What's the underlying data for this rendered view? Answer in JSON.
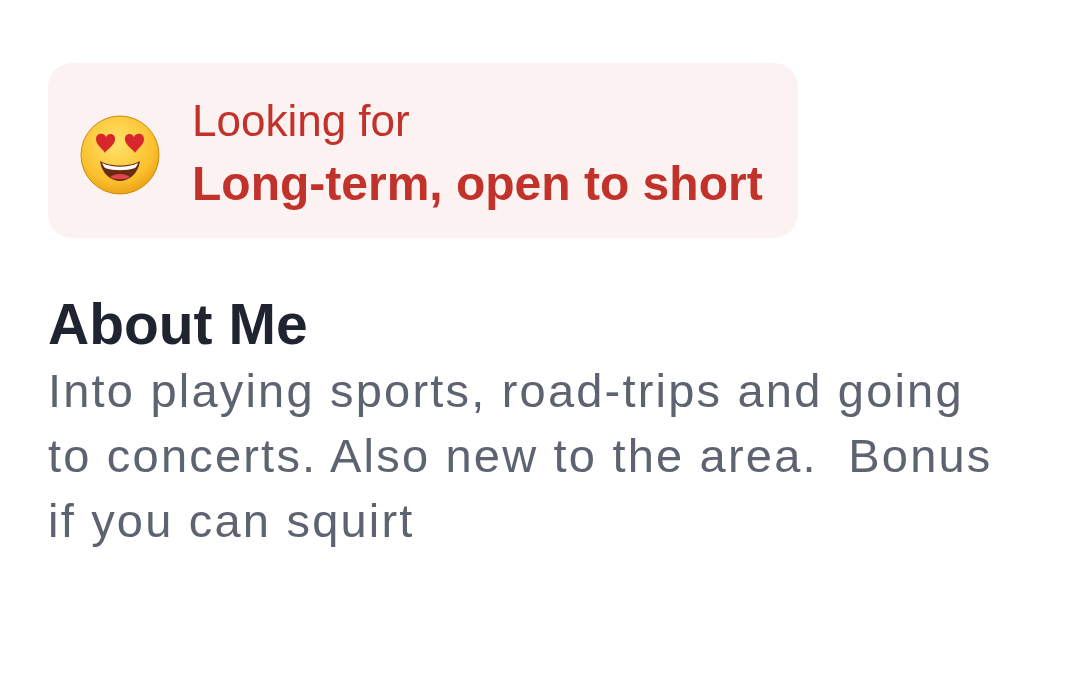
{
  "looking_for": {
    "label": "Looking for",
    "value": "Long-term, open to short"
  },
  "about_me": {
    "heading": "About Me",
    "text": "Into playing sports, road-trips and going to concerts. Also new to the area.  Bonus if you can squirt"
  }
}
